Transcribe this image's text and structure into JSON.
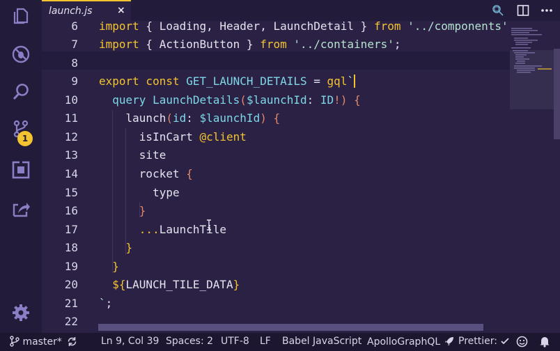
{
  "tab": {
    "filename": "launch.js",
    "close": "×"
  },
  "badge": {
    "count": "1"
  },
  "gutter": [
    "6",
    "7",
    "8",
    "9",
    "10",
    "11",
    "12",
    "13",
    "14",
    "15",
    "16",
    "17",
    "18",
    "19",
    "20",
    "21",
    "22"
  ],
  "code": {
    "l6a": "import",
    "l6b": " { Loading, Header, LaunchDetail } ",
    "l6c": "from",
    "l6d": " '../components'",
    "l7a": "import",
    "l7b": " { ActionButton } ",
    "l7c": "from",
    "l7d": " '../containers'",
    "l7e": ";",
    "l9a": "export const ",
    "l9b": "GET_LAUNCH_DETAILS",
    "l9c": " = ",
    "l9d": "gql",
    "l9e": "`",
    "l10a": "  query ",
    "l10b": "LaunchDetails",
    "l10c": "(",
    "l10d": "$launchId",
    "l10e": ": ",
    "l10f": "ID",
    "l10g": "!",
    "l10h": ") ",
    "l10i": "{",
    "l11a": "    launch",
    "l11b": "(",
    "l11c": "id",
    "l11d": ": ",
    "l11e": "$launchId",
    "l11f": ") ",
    "l11g": "{",
    "l12a": "      isInCart ",
    "l12b": "@client",
    "l13": "      site",
    "l14a": "      rocket ",
    "l14b": "{",
    "l15": "        type",
    "l16": "      }",
    "l17a": "      ...",
    "l17b": "LaunchTile",
    "l18": "    }",
    "l19": "  }",
    "l20a": "  ${",
    "l20b": "LAUNCH_TILE_DATA",
    "l20c": "}",
    "l21a": "`",
    "l21b": ";"
  },
  "status": {
    "branch": "master*",
    "position": "Ln 9, Col 39",
    "spaces": "Spaces: 2",
    "encoding": "UTF-8",
    "eol": "LF",
    "language": "Babel JavaScript",
    "extension": "ApolloGraphQL",
    "prettier": "Prettier:"
  },
  "colors": {
    "accent": "#f4c430",
    "background": "#2a2144",
    "sidebar": "#231b3a",
    "statusbar": "#1d1630"
  }
}
